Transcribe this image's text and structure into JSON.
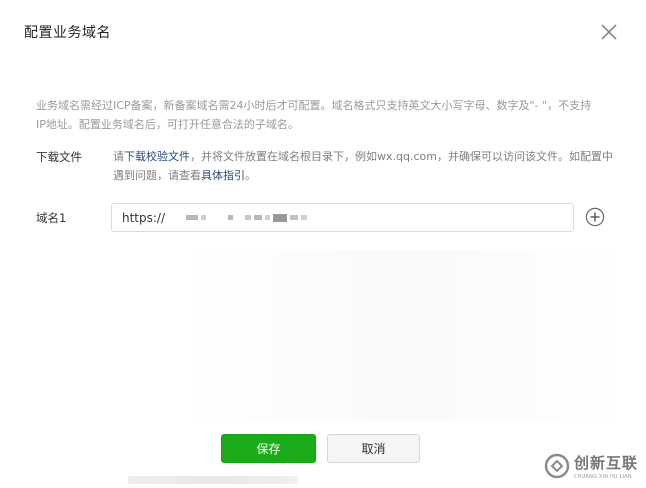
{
  "dialog": {
    "title": "配置业务域名",
    "description": "业务域名需经过ICP备案，新备案域名需24小时后才可配置。域名格式只支持英文大小写字母、数字及\"- \"，不支持IP地址。配置业务域名后，可打开任意合法的子域名。",
    "download": {
      "label": "下载文件",
      "text_prefix": "请",
      "link_file": "下载校验文件",
      "text_middle": "，并将文件放置在域名根目录下，例如wx.qq.com，并确保可以访问该文件。如配置中遇到问题，请查看",
      "link_guide": "具体指引",
      "text_suffix": "。"
    },
    "domain": {
      "label": "域名1",
      "value": "https://"
    },
    "buttons": {
      "save": "保存",
      "cancel": "取消"
    }
  },
  "watermark": {
    "name": "创新互联",
    "sub": "CHUANG XIN HU LIAN"
  },
  "colors": {
    "primary_green": "#1aad19",
    "link": "#2b4a7a",
    "muted_text": "#9a9a9a"
  },
  "icons": {
    "close": "close-icon",
    "add": "plus-circle-icon"
  }
}
